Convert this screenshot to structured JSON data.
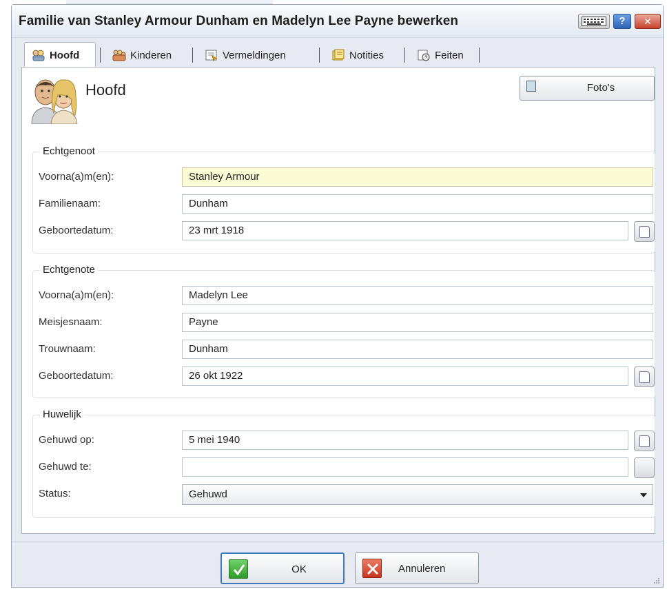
{
  "window": {
    "title": "Familie van Stanley Armour Dunham en Madelyn Lee Payne bewerken",
    "help_label": "?",
    "close_label": "✕"
  },
  "tabs": [
    {
      "label": "Hoofd",
      "icon": "couple-icon",
      "active": true
    },
    {
      "label": "Kinderen",
      "icon": "children-icon",
      "active": false
    },
    {
      "label": "Vermeldingen",
      "icon": "citations-icon",
      "active": false
    },
    {
      "label": "Notities",
      "icon": "notes-icon",
      "active": false
    },
    {
      "label": "Feiten",
      "icon": "facts-icon",
      "active": false
    }
  ],
  "header": {
    "title": "Hoofd",
    "photos_label": "Foto's"
  },
  "husband": {
    "legend": "Echtgenoot",
    "given_names_label": "Voorna(a)m(en):",
    "given_names": "Stanley Armour",
    "surname_label": "Familienaam:",
    "surname": "Dunham",
    "birth_label": "Geboortedatum:",
    "birth": "23 mrt 1918"
  },
  "wife": {
    "legend": "Echtgenote",
    "given_names_label": "Voorna(a)m(en):",
    "given_names": "Madelyn Lee",
    "maiden_label": "Meisjesnaam:",
    "maiden": "Payne",
    "married_name_label": "Trouwnaam:",
    "married_name": "Dunham",
    "birth_label": "Geboortedatum:",
    "birth": "26 okt 1922"
  },
  "marriage": {
    "legend": "Huwelijk",
    "date_label": "Gehuwd op:",
    "date": "5 mei 1940",
    "place_label": "Gehuwd te:",
    "place": "",
    "status_label": "Status:",
    "status": "Gehuwd"
  },
  "footer": {
    "ok_label": "OK",
    "cancel_label": "Annuleren"
  },
  "colors": {
    "accent": "#3d77bf",
    "highlight_field": "#fbfbd6"
  }
}
